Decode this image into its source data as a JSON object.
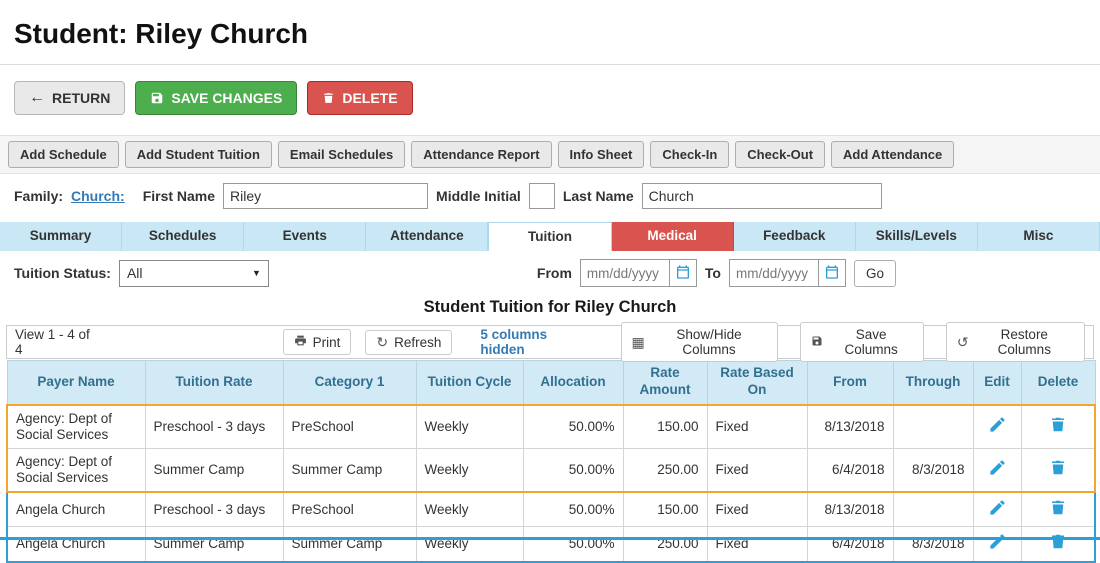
{
  "page": {
    "title": "Student: Riley Church"
  },
  "actions": {
    "return": "RETURN",
    "save": "SAVE CHANGES",
    "delete": "DELETE"
  },
  "nav_buttons": [
    "Add Schedule",
    "Add Student Tuition",
    "Email Schedules",
    "Attendance Report",
    "Info Sheet",
    "Check-In",
    "Check-Out",
    "Add Attendance"
  ],
  "form": {
    "family_label": "Family:",
    "family_link": "Church:",
    "first_name_label": "First Name",
    "first_name_value": "Riley",
    "middle_initial_label": "Middle Initial",
    "middle_initial_value": "",
    "last_name_label": "Last Name",
    "last_name_value": "Church"
  },
  "tabs": [
    {
      "label": "Summary"
    },
    {
      "label": "Schedules"
    },
    {
      "label": "Events"
    },
    {
      "label": "Attendance"
    },
    {
      "label": "Tuition",
      "state": "active"
    },
    {
      "label": "Medical",
      "state": "alert-red"
    },
    {
      "label": "Feedback"
    },
    {
      "label": "Skills/Levels"
    },
    {
      "label": "Misc"
    }
  ],
  "filters": {
    "tuition_status_label": "Tuition Status:",
    "tuition_status_value": "All",
    "from_label": "From",
    "to_label": "To",
    "date_placeholder": "mm/dd/yyyy",
    "go_label": "Go"
  },
  "section_title": "Student Tuition for Riley Church",
  "toolbar": {
    "view_text": "View 1 - 4 of 4",
    "print_label": "Print",
    "refresh_label": "Refresh",
    "columns_hidden_link": "5 columns hidden",
    "show_hide_label": "Show/Hide Columns",
    "save_columns_label": "Save Columns",
    "restore_columns_label": "Restore Columns"
  },
  "table": {
    "headers": [
      "Payer Name",
      "Tuition Rate",
      "Category 1",
      "Tuition Cycle",
      "Allocation",
      "Rate Amount",
      "Rate Based On",
      "From",
      "Through",
      "Edit",
      "Delete"
    ],
    "rows": [
      {
        "payer": "Agency: Dept of Social Services",
        "tuition_rate": "Preschool - 3 days",
        "category1": "PreSchool",
        "cycle": "Weekly",
        "allocation": "50.00%",
        "rate_amount": "150.00",
        "rate_based_on": "Fixed",
        "from": "8/13/2018",
        "through": "",
        "group": "orange"
      },
      {
        "payer": "Agency: Dept of Social Services",
        "tuition_rate": "Summer Camp",
        "category1": "Summer Camp",
        "cycle": "Weekly",
        "allocation": "50.00%",
        "rate_amount": "250.00",
        "rate_based_on": "Fixed",
        "from": "6/4/2018",
        "through": "8/3/2018",
        "group": "orange"
      },
      {
        "payer": "Angela Church",
        "tuition_rate": "Preschool - 3 days",
        "category1": "PreSchool",
        "cycle": "Weekly",
        "allocation": "50.00%",
        "rate_amount": "150.00",
        "rate_based_on": "Fixed",
        "from": "8/13/2018",
        "through": "",
        "group": "blue"
      },
      {
        "payer": "Angela Church",
        "tuition_rate": "Summer Camp",
        "category1": "Summer Camp",
        "cycle": "Weekly",
        "allocation": "50.00%",
        "rate_amount": "250.00",
        "rate_based_on": "Fixed",
        "from": "6/4/2018",
        "through": "8/3/2018",
        "group": "blue"
      }
    ]
  },
  "colors": {
    "save_green": "#4cae4c",
    "delete_red": "#d9534f",
    "medical_tab_red": "#d9534f",
    "tab_blue": "#c9e7f5",
    "table_header_bg": "#d2e9f6",
    "table_header_text": "#31708f",
    "link_blue": "#337ab7",
    "icon_blue": "#2d9fd8",
    "row_group_orange": "#f3a62f",
    "row_group_blue": "#2d9fd8"
  }
}
